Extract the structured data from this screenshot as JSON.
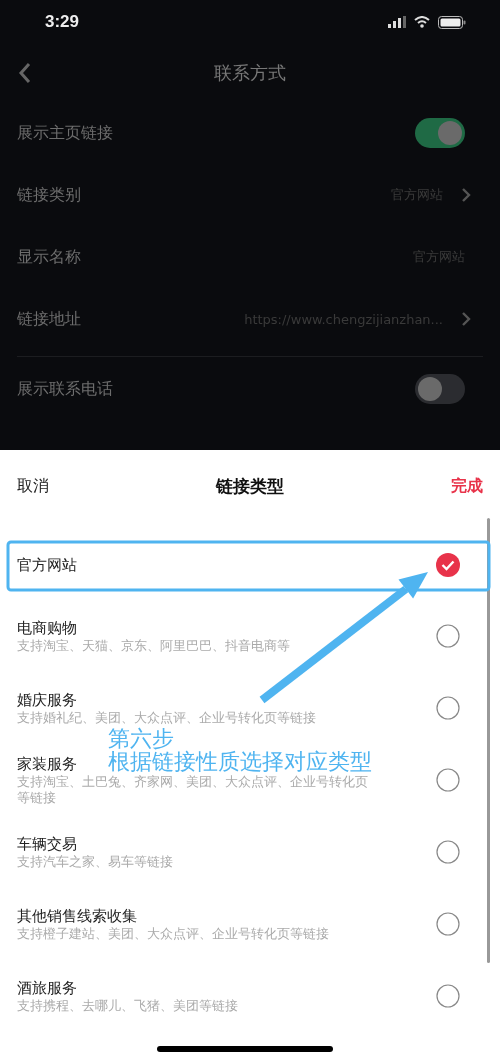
{
  "status_bar": {
    "time": "3:29"
  },
  "nav": {
    "title": "联系方式"
  },
  "settings": [
    {
      "kind": "toggle",
      "label": "展示主页链接",
      "on": true
    },
    {
      "kind": "nav",
      "label": "链接类别",
      "value": "官方网站"
    },
    {
      "kind": "value",
      "label": "显示名称",
      "value": "官方网站"
    },
    {
      "kind": "nav",
      "label": "链接地址",
      "value": "https://www.chengzijianzhan..."
    },
    {
      "kind": "toggle",
      "label": "展示联系电话",
      "on": false,
      "divider_before": true
    }
  ],
  "sheet": {
    "cancel": "取消",
    "title": "链接类型",
    "done": "完成",
    "options": [
      {
        "title": "官方网站",
        "selected": true
      },
      {
        "title": "电商购物",
        "description": "支持淘宝、天猫、京东、阿里巴巴、抖音电商等",
        "selected": false
      },
      {
        "title": "婚庆服务",
        "description": "支持婚礼纪、美团、大众点评、企业号转化页等链接",
        "selected": false
      },
      {
        "title": "家装服务",
        "description": "支持淘宝、土巴兔、齐家网、美团、大众点评、企业号转化页等链接",
        "selected": false
      },
      {
        "title": "车辆交易",
        "description": "支持汽车之家、易车等链接",
        "selected": false
      },
      {
        "title": "其他销售线索收集",
        "description": "支持橙子建站、美团、大众点评、企业号转化页等链接",
        "selected": false
      },
      {
        "title": "酒旅服务",
        "description": "支持携程、去哪儿、飞猪、美团等链接",
        "selected": false
      }
    ]
  },
  "annotation": {
    "step": "第六步",
    "text": "根据链接性质选择对应类型"
  }
}
